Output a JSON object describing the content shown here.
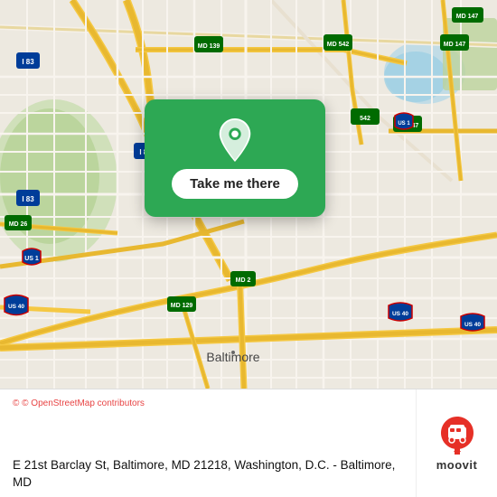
{
  "map": {
    "card": {
      "button_label": "Take me there"
    }
  },
  "info_bar": {
    "osm_credit": "© OpenStreetMap contributors",
    "address": "E 21st Barclay St, Baltimore, MD 21218, Washington,\nD.C. - Baltimore, MD",
    "moovit_label": "moovit"
  },
  "icons": {
    "pin": "location-pin-icon",
    "moovit": "moovit-logo-icon"
  },
  "colors": {
    "green": "#2da854",
    "red_osm": "#e84444",
    "moovit_red": "#e63027"
  }
}
